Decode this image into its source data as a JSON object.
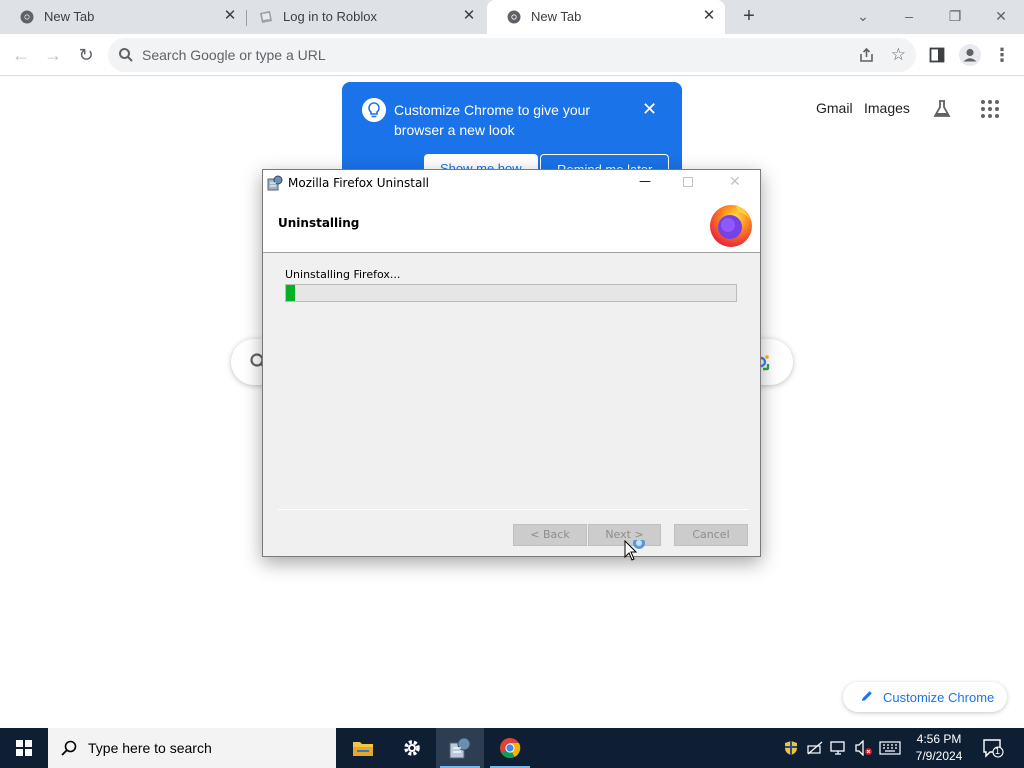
{
  "browser": {
    "tabs": [
      {
        "title": "New Tab",
        "active": false
      },
      {
        "title": "Log in to Roblox",
        "active": false
      },
      {
        "title": "New Tab",
        "active": true
      }
    ],
    "omnibox_placeholder": "Search Google or type a URL"
  },
  "ntp": {
    "gmail_label": "Gmail",
    "images_label": "Images",
    "promo": {
      "text": "Customize Chrome to give your browser a new look",
      "show_me_how": "Show me how",
      "remind_later": "Remind me later"
    },
    "customize_label": "Customize Chrome"
  },
  "dialog": {
    "title": "Mozilla Firefox Uninstall",
    "heading": "Uninstalling",
    "status": "Uninstalling Firefox...",
    "progress_fraction": 0.005,
    "back_label": "< Back",
    "next_label": "Next >",
    "cancel_label": "Cancel"
  },
  "taskbar": {
    "search_placeholder": "Type here to search",
    "time": "4:56 PM",
    "date": "7/9/2024",
    "notification_count": "1"
  },
  "colors": {
    "chrome_blue": "#1a73e8",
    "progress_green": "#06b025",
    "taskbar": "#0f1f33"
  }
}
